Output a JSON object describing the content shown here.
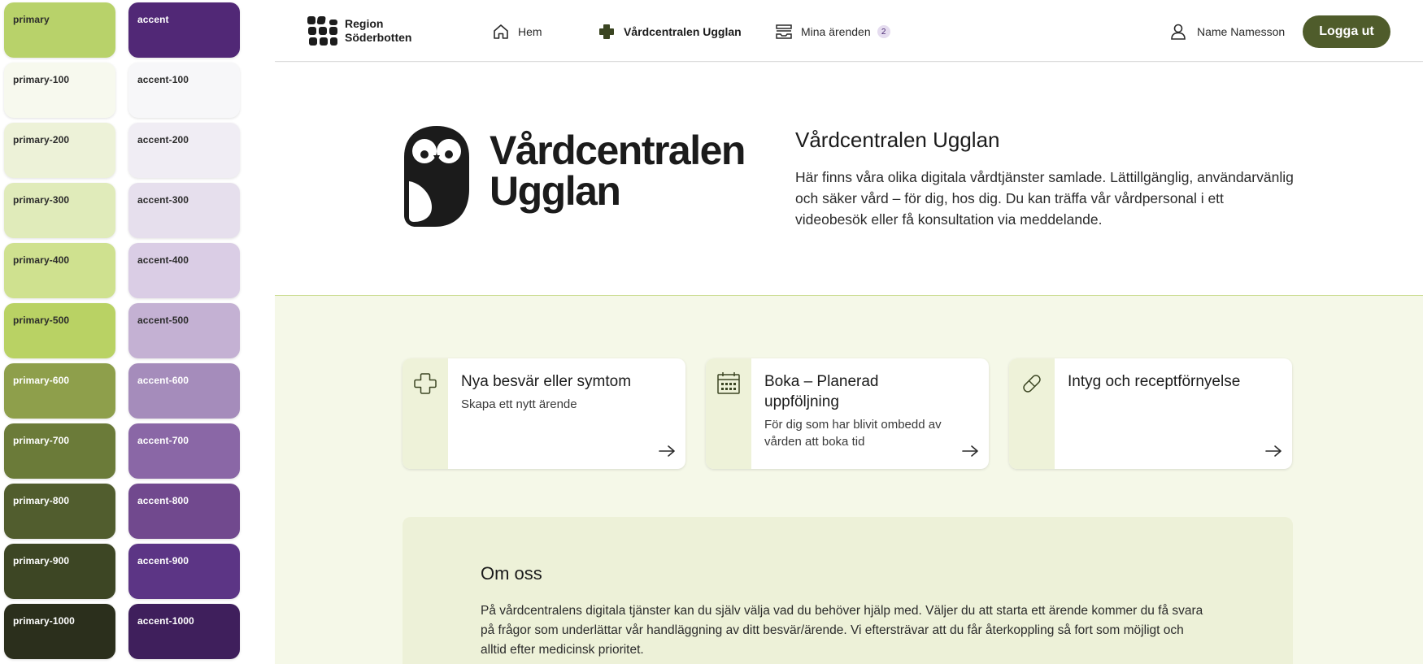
{
  "palette": {
    "primary": [
      {
        "label": "primary",
        "color": "#b8d26a",
        "text": "#2b2b2b"
      },
      {
        "label": "primary-100",
        "color": "#f7f9ee",
        "text": "#2b2b2b"
      },
      {
        "label": "primary-200",
        "color": "#edf2d8",
        "text": "#2b2b2b"
      },
      {
        "label": "primary-300",
        "color": "#e0ebba",
        "text": "#2b2b2b"
      },
      {
        "label": "primary-400",
        "color": "#cfe18f",
        "text": "#2b2b2b"
      },
      {
        "label": "primary-500",
        "color": "#b9d264",
        "text": "#2b2b2b"
      },
      {
        "label": "primary-600",
        "color": "#8e9f4b",
        "text": "#ffffff"
      },
      {
        "label": "primary-700",
        "color": "#6b7b39",
        "text": "#ffffff"
      },
      {
        "label": "primary-800",
        "color": "#515d2e",
        "text": "#ffffff"
      },
      {
        "label": "primary-900",
        "color": "#3d4624",
        "text": "#ffffff"
      },
      {
        "label": "primary-1000",
        "color": "#2b2f1c",
        "text": "#ffffff"
      }
    ],
    "accent": [
      {
        "label": "accent",
        "color": "#512876",
        "text": "#ffffff"
      },
      {
        "label": "accent-100",
        "color": "#f7f7f9",
        "text": "#2b2b2b"
      },
      {
        "label": "accent-200",
        "color": "#f0edf4",
        "text": "#2b2b2b"
      },
      {
        "label": "accent-300",
        "color": "#e6dfed",
        "text": "#2b2b2b"
      },
      {
        "label": "accent-400",
        "color": "#dacde5",
        "text": "#2b2b2b"
      },
      {
        "label": "accent-500",
        "color": "#c4b1d3",
        "text": "#2b2b2b"
      },
      {
        "label": "accent-600",
        "color": "#a58cbb",
        "text": "#ffffff"
      },
      {
        "label": "accent-700",
        "color": "#8a67a6",
        "text": "#ffffff"
      },
      {
        "label": "accent-800",
        "color": "#71498e",
        "text": "#ffffff"
      },
      {
        "label": "accent-900",
        "color": "#5c3585",
        "text": "#ffffff"
      },
      {
        "label": "accent-1000",
        "color": "#3f1f5c",
        "text": "#ffffff"
      }
    ]
  },
  "header": {
    "logo_line1": "Region",
    "logo_line2": "Söderbotten",
    "nav": {
      "home": "Hem",
      "vardcentral": "Vårdcentralen Ugglan",
      "cases": "Mina ärenden",
      "cases_count": "2"
    },
    "user_name": "Name Namesson",
    "logout": "Logga ut"
  },
  "hero": {
    "brand_line1": "Vårdcentralen",
    "brand_line2": "Ugglan",
    "title": "Vårdcentralen Ugglan",
    "description": "Här finns våra olika digitala vårdtjänster samlade. Lättillgänglig, användarvänlig och säker vård – för dig, hos dig. Du kan träffa vår vårdpersonal i ett videobesök eller få konsultation via meddelande."
  },
  "services": [
    {
      "title": "Nya besvär eller symtom",
      "subtitle": "Skapa ett nytt ärende",
      "icon": "medical-cross-icon"
    },
    {
      "title": "Boka – Planerad uppföljning",
      "subtitle": "För dig som har blivit ombedd av vården att boka tid",
      "icon": "calendar-icon"
    },
    {
      "title": "Intyg och receptförnyelse",
      "subtitle": "",
      "icon": "pill-icon"
    }
  ],
  "about": {
    "title": "Om oss",
    "text": "På vårdcentralens digitala tjänster kan du själv välja vad du behöver hjälp med. Väljer du att starta ett ärende kommer du få svara på frågor som underlättar vår handläggning av ditt besvär/ärende. Vi eftersträvar att du får återkoppling så fort som möjligt och alltid efter medicinsk prioritet."
  },
  "colors": {
    "brand_dark": "#4f5c2b",
    "services_bg": "#f5f8e8",
    "about_bg": "#edf1d8",
    "card_strip": "#eef2d9",
    "badge_bg": "#e5dcef"
  }
}
